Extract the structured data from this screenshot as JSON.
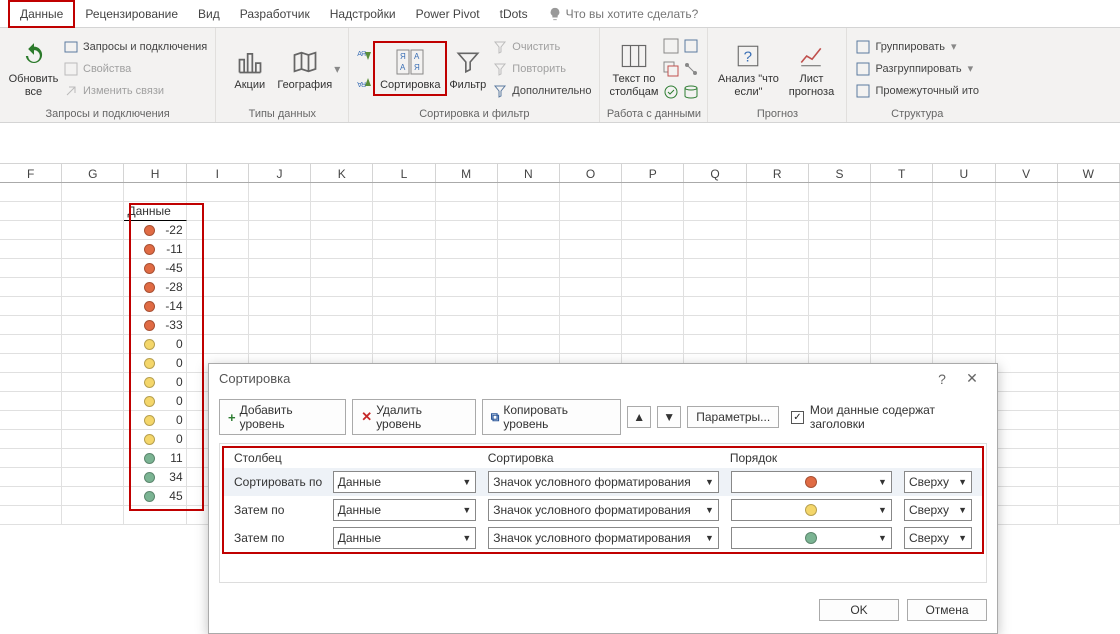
{
  "tabs": {
    "data": "Данные",
    "review": "Рецензирование",
    "view": "Вид",
    "developer": "Разработчик",
    "addins": "Надстройки",
    "powerpivot": "Power Pivot",
    "tdots": "tDots",
    "tellme": "Что вы хотите сделать?"
  },
  "ribbon": {
    "refresh": "Обновить\nвсе",
    "queries": "Запросы и подключения",
    "properties": "Свойства",
    "editlinks": "Изменить связи",
    "group_connections": "Запросы и подключения",
    "stocks": "Акции",
    "geography": "География",
    "group_datatypes": "Типы данных",
    "sort": "Сортировка",
    "filter": "Фильтр",
    "clear": "Очистить",
    "reapply": "Повторить",
    "advanced": "Дополнительно",
    "group_sortfilter": "Сортировка и фильтр",
    "texttocols": "Текст по\nстолбцам",
    "group_datatools": "Работа с данными",
    "whatif": "Анализ \"что\nесли\"",
    "forecast": "Лист\nпрогноза",
    "group_forecast": "Прогноз",
    "grp": "Группировать",
    "ungrp": "Разгруппировать",
    "subtotal": "Промежуточный ито",
    "group_outline": "Структура"
  },
  "columns": [
    "F",
    "G",
    "H",
    "I",
    "J",
    "K",
    "L",
    "M",
    "N",
    "O",
    "P",
    "Q",
    "R",
    "S",
    "T",
    "U",
    "V",
    "W"
  ],
  "table": {
    "header": "Данные",
    "rows": [
      {
        "color": "red",
        "val": "-22"
      },
      {
        "color": "red",
        "val": "-11"
      },
      {
        "color": "red",
        "val": "-45"
      },
      {
        "color": "red",
        "val": "-28"
      },
      {
        "color": "red",
        "val": "-14"
      },
      {
        "color": "red",
        "val": "-33"
      },
      {
        "color": "yellow",
        "val": "0"
      },
      {
        "color": "yellow",
        "val": "0"
      },
      {
        "color": "yellow",
        "val": "0"
      },
      {
        "color": "yellow",
        "val": "0"
      },
      {
        "color": "yellow",
        "val": "0"
      },
      {
        "color": "yellow",
        "val": "0"
      },
      {
        "color": "green",
        "val": "11"
      },
      {
        "color": "green",
        "val": "34"
      },
      {
        "color": "green",
        "val": "45"
      }
    ]
  },
  "dialog": {
    "title": "Сортировка",
    "addlevel": "Добавить уровень",
    "dellevel": "Удалить уровень",
    "copylevel": "Копировать уровень",
    "params": "Параметры...",
    "hasheaders": "Мои данные содержат заголовки",
    "head_column": "Столбец",
    "head_sort": "Сортировка",
    "head_order": "Порядок",
    "sortby": "Сортировать по",
    "thenby": "Затем по",
    "col_value": "Данные",
    "sort_value": "Значок условного форматирования",
    "dir_value": "Сверху",
    "ok": "OK",
    "cancel": "Отмена",
    "rules": [
      "red",
      "yellow",
      "green"
    ]
  }
}
